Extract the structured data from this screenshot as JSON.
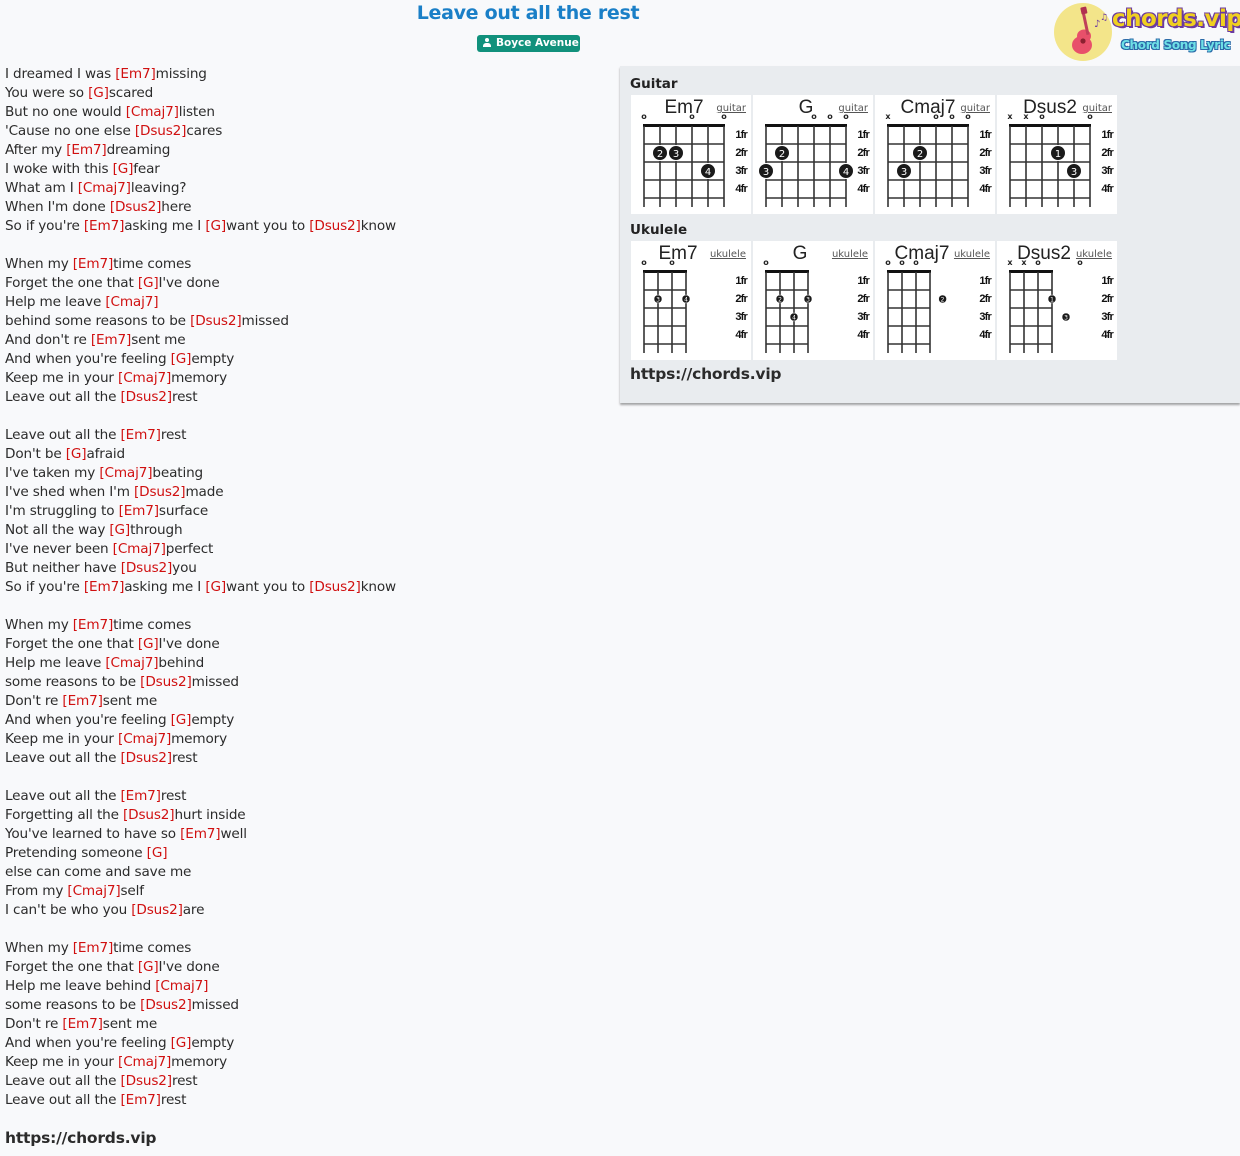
{
  "song": {
    "title": "Leave out all the rest",
    "artist": "Boyce Avenue"
  },
  "logo": {
    "brand": "chords.vip",
    "tagline": "Chord Song Lyric",
    "icon": "guitar-icon"
  },
  "lyrics": [
    {
      "parts": [
        {
          "t": "I dreamed I was "
        },
        {
          "c": "[Em7]"
        },
        {
          "t": "missing"
        }
      ]
    },
    {
      "parts": [
        {
          "t": "You were so "
        },
        {
          "c": "[G]"
        },
        {
          "t": "scared"
        }
      ]
    },
    {
      "parts": [
        {
          "t": "But no one would "
        },
        {
          "c": "[Cmaj7]"
        },
        {
          "t": "listen"
        }
      ]
    },
    {
      "parts": [
        {
          "t": "'Cause no one else "
        },
        {
          "c": "[Dsus2]"
        },
        {
          "t": "cares"
        }
      ]
    },
    {
      "parts": [
        {
          "t": "After my "
        },
        {
          "c": "[Em7]"
        },
        {
          "t": "dreaming"
        }
      ]
    },
    {
      "parts": [
        {
          "t": "I woke with this "
        },
        {
          "c": "[G]"
        },
        {
          "t": "fear"
        }
      ]
    },
    {
      "parts": [
        {
          "t": "What am I "
        },
        {
          "c": "[Cmaj7]"
        },
        {
          "t": "leaving?"
        }
      ]
    },
    {
      "parts": [
        {
          "t": "When I'm done "
        },
        {
          "c": "[Dsus2]"
        },
        {
          "t": "here"
        }
      ]
    },
    {
      "parts": [
        {
          "t": "So if you're "
        },
        {
          "c": "[Em7]"
        },
        {
          "t": "asking me I "
        },
        {
          "c": "[G]"
        },
        {
          "t": "want you to "
        },
        {
          "c": "[Dsus2]"
        },
        {
          "t": "know"
        }
      ]
    },
    {
      "parts": []
    },
    {
      "parts": [
        {
          "t": "When my "
        },
        {
          "c": "[Em7]"
        },
        {
          "t": "time comes"
        }
      ]
    },
    {
      "parts": [
        {
          "t": "Forget the one that "
        },
        {
          "c": "[G]"
        },
        {
          "t": "I've done"
        }
      ]
    },
    {
      "parts": [
        {
          "t": "Help me leave "
        },
        {
          "c": "[Cmaj7]"
        }
      ]
    },
    {
      "parts": [
        {
          "t": "behind some reasons to be "
        },
        {
          "c": "[Dsus2]"
        },
        {
          "t": "missed"
        }
      ]
    },
    {
      "parts": [
        {
          "t": "And don't re "
        },
        {
          "c": "[Em7]"
        },
        {
          "t": "sent me"
        }
      ]
    },
    {
      "parts": [
        {
          "t": "And when you're feeling "
        },
        {
          "c": "[G]"
        },
        {
          "t": "empty"
        }
      ]
    },
    {
      "parts": [
        {
          "t": "Keep me in your "
        },
        {
          "c": "[Cmaj7]"
        },
        {
          "t": "memory"
        }
      ]
    },
    {
      "parts": [
        {
          "t": "Leave out all the "
        },
        {
          "c": "[Dsus2]"
        },
        {
          "t": "rest"
        }
      ]
    },
    {
      "parts": []
    },
    {
      "parts": [
        {
          "t": "Leave out all the "
        },
        {
          "c": "[Em7]"
        },
        {
          "t": "rest"
        }
      ]
    },
    {
      "parts": [
        {
          "t": "Don't be "
        },
        {
          "c": "[G]"
        },
        {
          "t": "afraid"
        }
      ]
    },
    {
      "parts": [
        {
          "t": "I've taken my "
        },
        {
          "c": "[Cmaj7]"
        },
        {
          "t": "beating"
        }
      ]
    },
    {
      "parts": [
        {
          "t": "I've shed when I'm "
        },
        {
          "c": "[Dsus2]"
        },
        {
          "t": "made"
        }
      ]
    },
    {
      "parts": [
        {
          "t": "I'm struggling to "
        },
        {
          "c": "[Em7]"
        },
        {
          "t": "surface"
        }
      ]
    },
    {
      "parts": [
        {
          "t": "Not all the way "
        },
        {
          "c": "[G]"
        },
        {
          "t": "through"
        }
      ]
    },
    {
      "parts": [
        {
          "t": "I've never been "
        },
        {
          "c": "[Cmaj7]"
        },
        {
          "t": "perfect"
        }
      ]
    },
    {
      "parts": [
        {
          "t": "But neither have "
        },
        {
          "c": "[Dsus2]"
        },
        {
          "t": "you"
        }
      ]
    },
    {
      "parts": [
        {
          "t": "So if you're "
        },
        {
          "c": "[Em7]"
        },
        {
          "t": "asking me I "
        },
        {
          "c": "[G]"
        },
        {
          "t": "want you to "
        },
        {
          "c": "[Dsus2]"
        },
        {
          "t": "know"
        }
      ]
    },
    {
      "parts": []
    },
    {
      "parts": [
        {
          "t": "When my "
        },
        {
          "c": "[Em7]"
        },
        {
          "t": "time comes"
        }
      ]
    },
    {
      "parts": [
        {
          "t": "Forget the one that "
        },
        {
          "c": "[G]"
        },
        {
          "t": "I've done"
        }
      ]
    },
    {
      "parts": [
        {
          "t": "Help me leave "
        },
        {
          "c": "[Cmaj7]"
        },
        {
          "t": "behind"
        }
      ]
    },
    {
      "parts": [
        {
          "t": "some reasons to be "
        },
        {
          "c": "[Dsus2]"
        },
        {
          "t": "missed"
        }
      ]
    },
    {
      "parts": [
        {
          "t": "Don't re "
        },
        {
          "c": "[Em7]"
        },
        {
          "t": "sent me"
        }
      ]
    },
    {
      "parts": [
        {
          "t": "And when you're feeling "
        },
        {
          "c": "[G]"
        },
        {
          "t": "empty"
        }
      ]
    },
    {
      "parts": [
        {
          "t": "Keep me in your "
        },
        {
          "c": "[Cmaj7]"
        },
        {
          "t": "memory"
        }
      ]
    },
    {
      "parts": [
        {
          "t": "Leave out all the "
        },
        {
          "c": "[Dsus2]"
        },
        {
          "t": "rest"
        }
      ]
    },
    {
      "parts": []
    },
    {
      "parts": [
        {
          "t": "Leave out all the "
        },
        {
          "c": "[Em7]"
        },
        {
          "t": "rest"
        }
      ]
    },
    {
      "parts": [
        {
          "t": "Forgetting all the "
        },
        {
          "c": "[Dsus2]"
        },
        {
          "t": "hurt inside"
        }
      ]
    },
    {
      "parts": [
        {
          "t": "You've learned to have so "
        },
        {
          "c": "[Em7]"
        },
        {
          "t": "well"
        }
      ]
    },
    {
      "parts": [
        {
          "t": "Pretending someone "
        },
        {
          "c": "[G]"
        }
      ]
    },
    {
      "parts": [
        {
          "t": "else can come and save me"
        }
      ]
    },
    {
      "parts": [
        {
          "t": "From my "
        },
        {
          "c": "[Cmaj7]"
        },
        {
          "t": "self"
        }
      ]
    },
    {
      "parts": [
        {
          "t": "I can't be who you "
        },
        {
          "c": "[Dsus2]"
        },
        {
          "t": "are"
        }
      ]
    },
    {
      "parts": []
    },
    {
      "parts": [
        {
          "t": "When my "
        },
        {
          "c": "[Em7]"
        },
        {
          "t": "time comes"
        }
      ]
    },
    {
      "parts": [
        {
          "t": "Forget the one that "
        },
        {
          "c": "[G]"
        },
        {
          "t": "I've done"
        }
      ]
    },
    {
      "parts": [
        {
          "t": "Help me leave behind "
        },
        {
          "c": "[Cmaj7]"
        }
      ]
    },
    {
      "parts": [
        {
          "t": "some reasons to be "
        },
        {
          "c": "[Dsus2]"
        },
        {
          "t": "missed"
        }
      ]
    },
    {
      "parts": [
        {
          "t": "Don't re "
        },
        {
          "c": "[Em7]"
        },
        {
          "t": "sent me"
        }
      ]
    },
    {
      "parts": [
        {
          "t": "And when you're feeling "
        },
        {
          "c": "[G]"
        },
        {
          "t": "empty"
        }
      ]
    },
    {
      "parts": [
        {
          "t": "Keep me in your "
        },
        {
          "c": "[Cmaj7]"
        },
        {
          "t": "memory"
        }
      ]
    },
    {
      "parts": [
        {
          "t": "Leave out all the "
        },
        {
          "c": "[Dsus2]"
        },
        {
          "t": "rest"
        }
      ]
    },
    {
      "parts": [
        {
          "t": "Leave out all the "
        },
        {
          "c": "[Em7]"
        },
        {
          "t": "rest"
        }
      ]
    }
  ],
  "footer_url": "https://chords.vip",
  "panel": {
    "guitar_heading": "Guitar",
    "ukulele_heading": "Ukulele",
    "url": "https://chords.vip",
    "fret_labels": [
      "1fr",
      "2fr",
      "3fr",
      "4fr"
    ],
    "guitar": [
      {
        "name": "Em7",
        "link": "guitar",
        "markers": [
          "o",
          "",
          "",
          "o",
          "",
          "o"
        ],
        "dots": [
          {
            "string": 2,
            "fret": 2,
            "finger": "2"
          },
          {
            "string": 3,
            "fret": 2,
            "finger": "3"
          },
          {
            "string": 5,
            "fret": 3,
            "finger": "4"
          }
        ]
      },
      {
        "name": "G",
        "link": "guitar",
        "markers": [
          "",
          "",
          "",
          "o",
          "o",
          "o"
        ],
        "dots": [
          {
            "string": 2,
            "fret": 2,
            "finger": "2"
          },
          {
            "string": 1,
            "fret": 3,
            "finger": "3"
          },
          {
            "string": 6,
            "fret": 3,
            "finger": "4"
          }
        ]
      },
      {
        "name": "Cmaj7",
        "link": "guitar",
        "markers": [
          "x",
          "",
          "",
          "o",
          "o",
          "o"
        ],
        "dots": [
          {
            "string": 3,
            "fret": 2,
            "finger": "2"
          },
          {
            "string": 2,
            "fret": 3,
            "finger": "3"
          }
        ]
      },
      {
        "name": "Dsus2",
        "link": "guitar",
        "markers": [
          "x",
          "x",
          "o",
          "",
          "",
          "o"
        ],
        "dots": [
          {
            "string": 4,
            "fret": 2,
            "finger": "1"
          },
          {
            "string": 5,
            "fret": 3,
            "finger": "3"
          }
        ]
      }
    ],
    "ukulele": [
      {
        "name": "Em7",
        "link": "ukulele",
        "markers": [
          "o",
          "",
          "o",
          ""
        ],
        "dots": [
          {
            "string": 2,
            "fret": 2,
            "finger": "3"
          },
          {
            "string": 4,
            "fret": 2,
            "finger": "4"
          }
        ]
      },
      {
        "name": "G",
        "link": "ukulele",
        "markers": [
          "o",
          "",
          "",
          ""
        ],
        "dots": [
          {
            "string": 2,
            "fret": 2,
            "finger": "2"
          },
          {
            "string": 4,
            "fret": 2,
            "finger": "3"
          },
          {
            "string": 3,
            "fret": 3,
            "finger": "4"
          }
        ]
      },
      {
        "name": "Cmaj7",
        "link": "ukulele",
        "markers": [
          "o",
          "o",
          "o",
          ""
        ],
        "dots": [
          {
            "string": 4.9,
            "fret": 2,
            "finger": "2"
          }
        ]
      },
      {
        "name": "Dsus2",
        "link": "ukulele",
        "markers": [
          "x",
          "x",
          "o",
          "",
          "",
          "o"
        ],
        "dots": [
          {
            "string": 4,
            "fret": 2,
            "finger": "1"
          },
          {
            "string": 5,
            "fret": 3,
            "finger": "3"
          }
        ]
      }
    ]
  }
}
